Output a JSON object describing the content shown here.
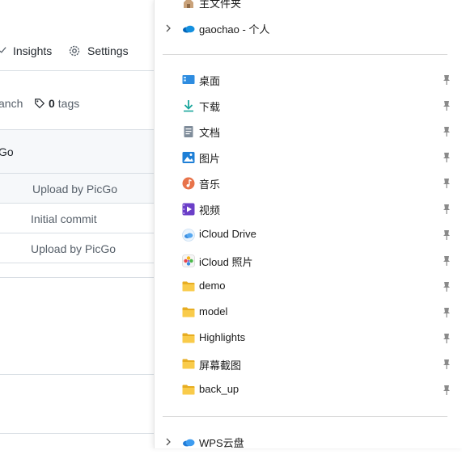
{
  "github": {
    "tabs": {
      "insights": "Insights",
      "settings": "Settings"
    },
    "branch_fragment": "anch",
    "tags_count": "0",
    "tags_label": "tags",
    "go_fragment": "Go",
    "commits": [
      "Upload by PicGo",
      "Initial commit",
      "Upload by PicGo"
    ]
  },
  "nav": {
    "top_partial": "主文件夹",
    "onedrive": "gaochao - 个人",
    "pinned": [
      {
        "label": "桌面",
        "icon": "desktop-icon"
      },
      {
        "label": "下载",
        "icon": "download-icon"
      },
      {
        "label": "文档",
        "icon": "document-icon"
      },
      {
        "label": "图片",
        "icon": "pictures-icon"
      },
      {
        "label": "音乐",
        "icon": "music-icon"
      },
      {
        "label": "视频",
        "icon": "video-icon"
      },
      {
        "label": "iCloud Drive",
        "icon": "icloud-drive-icon"
      },
      {
        "label": "iCloud 照片",
        "icon": "icloud-photos-icon"
      },
      {
        "label": "demo",
        "icon": "folder-icon"
      },
      {
        "label": "model",
        "icon": "folder-icon"
      },
      {
        "label": "Highlights",
        "icon": "folder-icon"
      },
      {
        "label": "屏幕截图",
        "icon": "folder-icon"
      },
      {
        "label": "back_up",
        "icon": "folder-icon"
      }
    ],
    "wps": "WPS云盘"
  },
  "colors": {
    "folder": "#f4c542",
    "onedrive": "#0078d4",
    "pin": "#8a8a8a"
  }
}
